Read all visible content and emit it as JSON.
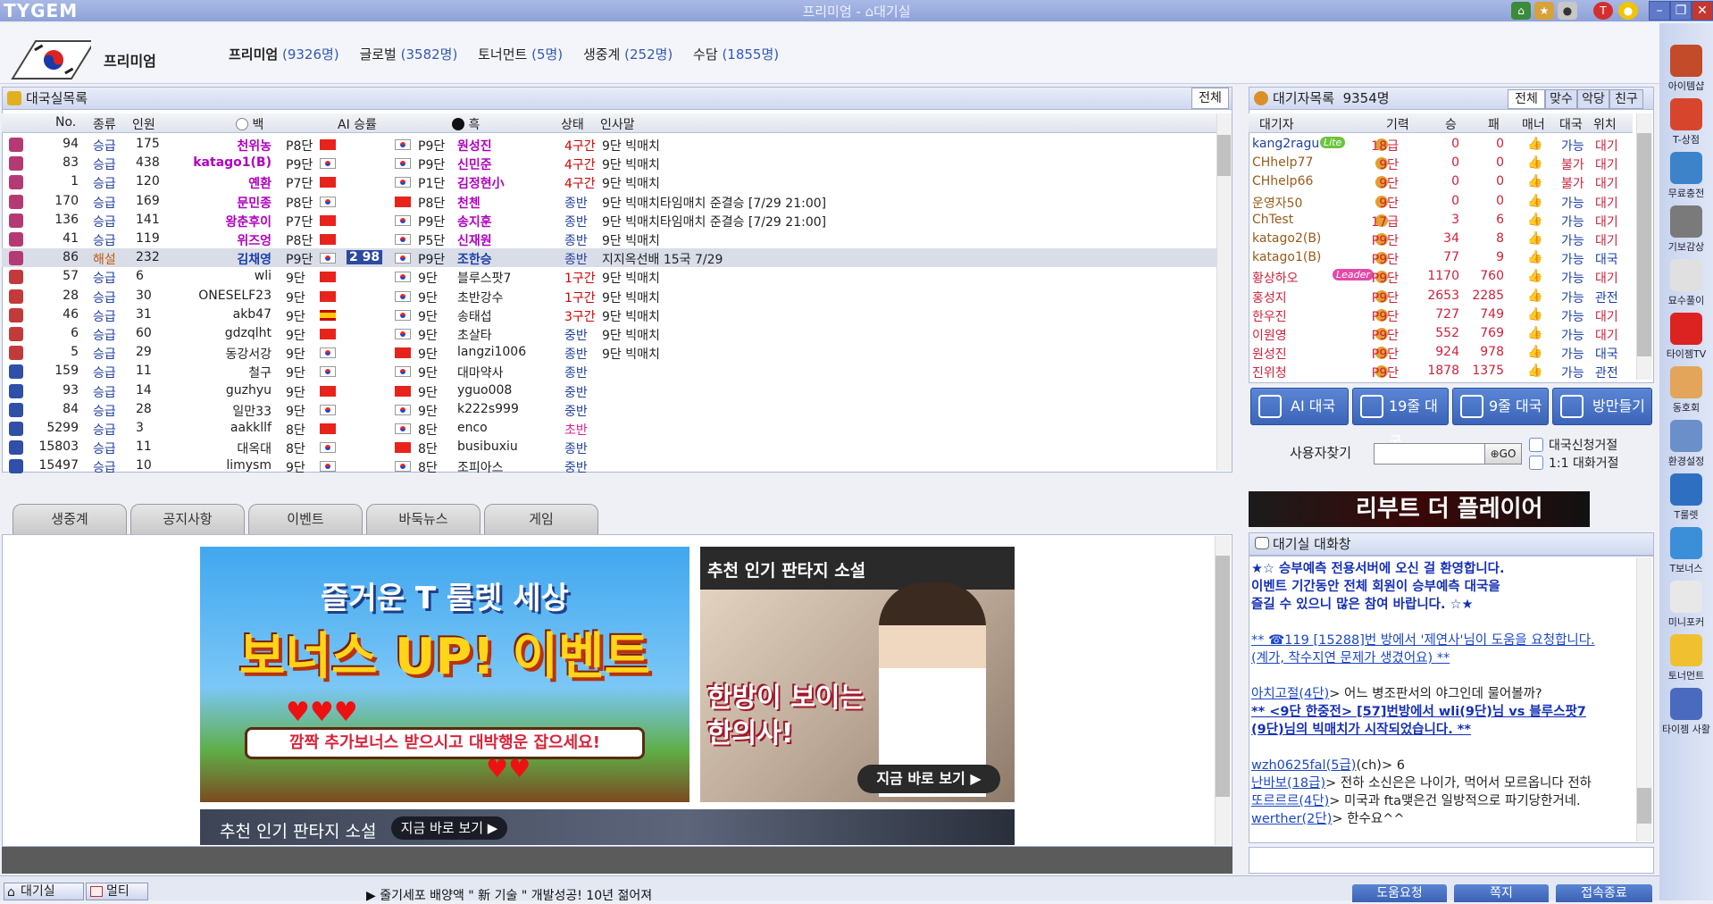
{
  "app": {
    "logo": "TYGEM",
    "window_title": "프리미엄 - ⌂대기실",
    "titlebar_icons": [
      "home-icon",
      "rank-icon",
      "puppy-icon",
      "t-icon",
      "bulb-icon"
    ]
  },
  "header": {
    "premium_label": "프리미엄",
    "servers": [
      {
        "name": "프리미엄",
        "count": "(9326명)"
      },
      {
        "name": "글로벌",
        "count": "(3582명)"
      },
      {
        "name": "토너먼트",
        "count": "(5명)"
      },
      {
        "name": "생중계",
        "count": "(252명)"
      },
      {
        "name": "수담",
        "count": "(1855명)"
      }
    ]
  },
  "gamelist": {
    "title": "대국실목록",
    "all_button": "전체",
    "columns": [
      "No.",
      "종류",
      "인원",
      "백",
      "AI 승률",
      "흑",
      "상태",
      "인사말"
    ],
    "rows": [
      {
        "no": "94",
        "type": "승급",
        "ppl": "175",
        "white": "천위농",
        "wrank": "P8단",
        "wflag": "cn",
        "bflag": "kr",
        "brank": "P9단",
        "black": "원성진",
        "state": "4구간",
        "msg": "9단 빅매치",
        "hl": "purple",
        "ic": "purple"
      },
      {
        "no": "83",
        "type": "승급",
        "ppl": "438",
        "white": "katago1(B)",
        "wrank": "P9단",
        "wflag": "kr",
        "bflag": "kr",
        "brank": "P9단",
        "black": "신민준",
        "state": "4구간",
        "msg": "9단 빅매치",
        "hl": "purple",
        "ic": "purple"
      },
      {
        "no": "1",
        "type": "승급",
        "ppl": "120",
        "white": "옌환",
        "wrank": "P7단",
        "wflag": "cn",
        "bflag": "kr",
        "brank": "P1단",
        "black": "김정현小",
        "state": "4구간",
        "msg": "9단 빅매치",
        "hl": "purple",
        "ic": "purple"
      },
      {
        "no": "170",
        "type": "승급",
        "ppl": "169",
        "white": "문민종",
        "wrank": "P8단",
        "wflag": "kr",
        "bflag": "cn",
        "brank": "P8단",
        "black": "천첸",
        "state": "종반",
        "msg": "9단 빅매치타임매치 준결승 [7/29 21:00]",
        "hl": "purple",
        "ic": "purple"
      },
      {
        "no": "136",
        "type": "승급",
        "ppl": "141",
        "white": "왕춘후이",
        "wrank": "P7단",
        "wflag": "cn",
        "bflag": "kr",
        "brank": "P9단",
        "black": "송지훈",
        "state": "종반",
        "msg": "9단 빅매치타임매치 준결승 [7/29 21:00]",
        "hl": "purple",
        "ic": "purple"
      },
      {
        "no": "41",
        "type": "승급",
        "ppl": "119",
        "white": "위즈엉",
        "wrank": "P8단",
        "wflag": "cn",
        "bflag": "kr",
        "brank": "P5단",
        "black": "신재원",
        "state": "종반",
        "msg": "9단 빅매치",
        "hl": "purple",
        "ic": "purple"
      },
      {
        "no": "86",
        "type": "해설",
        "ppl": "232",
        "white": "김채영",
        "wrank": "P9단",
        "wflag": "kr",
        "ai": "2 98",
        "bflag": "kr",
        "brank": "P9단",
        "black": "조한승",
        "state": "종반",
        "msg": "지지옥선배 15국 7/29",
        "hl": "blue",
        "ic": "purple",
        "sel": true
      },
      {
        "no": "57",
        "type": "승급",
        "ppl": "6",
        "white": "wli",
        "wrank": "9단",
        "wflag": "cn",
        "bflag": "kr",
        "brank": "9단",
        "black": "블루스팟7",
        "state": "1구간",
        "msg": "9단 빅매치",
        "hl": "none",
        "ic": "red"
      },
      {
        "no": "28",
        "type": "승급",
        "ppl": "30",
        "white": "ONESELF23",
        "wrank": "9단",
        "wflag": "cn",
        "bflag": "kr",
        "brank": "9단",
        "black": "초반강수",
        "state": "1구간",
        "msg": "9단 빅매치",
        "hl": "none",
        "ic": "red"
      },
      {
        "no": "46",
        "type": "승급",
        "ppl": "31",
        "white": "akb47",
        "wrank": "9단",
        "wflag": "es",
        "bflag": "kr",
        "brank": "9단",
        "black": "송태섭",
        "state": "3구간",
        "msg": "9단 빅매치",
        "hl": "none",
        "ic": "red"
      },
      {
        "no": "6",
        "type": "승급",
        "ppl": "60",
        "white": "gdzqlht",
        "wrank": "9단",
        "wflag": "cn",
        "bflag": "kr",
        "brank": "9단",
        "black": "초살타",
        "state": "중반",
        "msg": "9단 빅매치",
        "hl": "none",
        "ic": "red"
      },
      {
        "no": "5",
        "type": "승급",
        "ppl": "29",
        "white": "동강서강",
        "wrank": "9단",
        "wflag": "kr",
        "bflag": "cn",
        "brank": "9단",
        "black": "langzi1006",
        "state": "종반",
        "msg": "9단 빅매치",
        "hl": "none",
        "ic": "red"
      },
      {
        "no": "159",
        "type": "승급",
        "ppl": "11",
        "white": "철구",
        "wrank": "9단",
        "wflag": "kr",
        "bflag": "kr",
        "brank": "9단",
        "black": "대마약사",
        "state": "종반",
        "msg": "",
        "hl": "none",
        "ic": "blue"
      },
      {
        "no": "93",
        "type": "승급",
        "ppl": "14",
        "white": "guzhyu",
        "wrank": "9단",
        "wflag": "cn",
        "bflag": "cn",
        "brank": "9단",
        "black": "yguo008",
        "state": "중반",
        "msg": "",
        "hl": "none",
        "ic": "blue"
      },
      {
        "no": "84",
        "type": "승급",
        "ppl": "28",
        "white": "일만33",
        "wrank": "9단",
        "wflag": "kr",
        "bflag": "kr",
        "brank": "9단",
        "black": "k222s999",
        "state": "중반",
        "msg": "",
        "hl": "none",
        "ic": "blue"
      },
      {
        "no": "5299",
        "type": "승급",
        "ppl": "3",
        "white": "aakkllf",
        "wrank": "8단",
        "wflag": "cn",
        "bflag": "kr",
        "brank": "8단",
        "black": "enco",
        "state": "초반",
        "msg": "",
        "hl": "none",
        "ic": "blue"
      },
      {
        "no": "15803",
        "type": "승급",
        "ppl": "11",
        "white": "대옥대",
        "wrank": "8단",
        "wflag": "kr",
        "bflag": "cn",
        "brank": "8단",
        "black": "busibuxiu",
        "state": "종반",
        "msg": "",
        "hl": "none",
        "ic": "blue"
      },
      {
        "no": "15497",
        "type": "승급",
        "ppl": "10",
        "white": "limysm",
        "wrank": "9단",
        "wflag": "kr",
        "bflag": "kr",
        "brank": "8단",
        "black": "조피아스",
        "state": "중반",
        "msg": "",
        "hl": "none",
        "ic": "blue"
      }
    ]
  },
  "tabs": [
    "생중계",
    "공지사항",
    "이벤트",
    "바둑뉴스",
    "게임"
  ],
  "banners": {
    "b1_line1": "즐거운 T 룰렛 세상",
    "b1_line2": "보너스 UP! 이벤트",
    "b1_line3": "깜짝 추가보너스 받으시고 대박행운 잡으세요!",
    "b2_title": "추천 인기 판타지 소설",
    "b2_headline": "한방이 보이는 한의사!",
    "b2_cta": "지금 바로 보기 ▶",
    "b3_title": "추천 인기 판타지 소설",
    "b3_cta": "지금 바로 보기 ▶"
  },
  "waitlist": {
    "title": "대기자목록",
    "count": "9354명",
    "tabs": [
      "전체",
      "맞수",
      "악당",
      "친구"
    ],
    "columns": [
      "대기자",
      "기력",
      "승",
      "패",
      "매너",
      "대국",
      "위치"
    ],
    "rows": [
      {
        "name": "kang2ragu",
        "badge": "Lite",
        "rank": "18급",
        "w": "0",
        "l": "0",
        "game": "가능",
        "loc": "대기",
        "color": "blue"
      },
      {
        "name": "CHhelp77",
        "rank": "9단",
        "w": "0",
        "l": "0",
        "game": "불가",
        "loc": "대기",
        "color": "brown"
      },
      {
        "name": "CHhelp66",
        "rank": "9단",
        "w": "0",
        "l": "0",
        "game": "불가",
        "loc": "대기",
        "color": "brown"
      },
      {
        "name": "운영자50",
        "rank": "9단",
        "w": "0",
        "l": "0",
        "game": "가능",
        "loc": "대기",
        "color": "brown"
      },
      {
        "name": "ChTest",
        "rank": "17급",
        "w": "3",
        "l": "6",
        "game": "가능",
        "loc": "대기",
        "color": "brown"
      },
      {
        "name": "katago2(B)",
        "rank": "P9단",
        "w": "34",
        "l": "8",
        "game": "가능",
        "loc": "대기",
        "color": "brown"
      },
      {
        "name": "katago1(B)",
        "rank": "P9단",
        "w": "77",
        "l": "9",
        "game": "가능",
        "loc": "대국",
        "color": "brown"
      },
      {
        "name": "황상하오",
        "badge": "Leader",
        "rank": "P9단",
        "w": "1170",
        "l": "760",
        "game": "가능",
        "loc": "대기",
        "color": "red"
      },
      {
        "name": "홍성지",
        "rank": "P9단",
        "w": "2653",
        "l": "2285",
        "game": "가능",
        "loc": "관전",
        "color": "red"
      },
      {
        "name": "한우진",
        "rank": "P9단",
        "w": "727",
        "l": "749",
        "game": "가능",
        "loc": "대기",
        "color": "red"
      },
      {
        "name": "이원영",
        "rank": "P9단",
        "w": "552",
        "l": "769",
        "game": "가능",
        "loc": "대기",
        "color": "red"
      },
      {
        "name": "원성진",
        "rank": "P9단",
        "w": "924",
        "l": "978",
        "game": "가능",
        "loc": "대국",
        "color": "red"
      },
      {
        "name": "진위청",
        "rank": "P9단",
        "w": "1878",
        "l": "1375",
        "game": "가능",
        "loc": "관전",
        "color": "red"
      }
    ]
  },
  "actions": {
    "ai": "AI 대국",
    "b19": "19줄 대국",
    "b9": "9줄 대국",
    "make_room": "방만들기",
    "find_user": "사용자찾기",
    "go": "GO",
    "refuse_game": "대국신청거절",
    "refuse_chat": "1:1 대화거절"
  },
  "ad_banner": "리부트 더 플레이어",
  "chat": {
    "title": "대기실 대화창",
    "lines": [
      {
        "text": "★☆ 승부예측 전용서버에 오신 걸 환영합니다.",
        "style": "notice"
      },
      {
        "text": "이벤트 기간동안 전체 회원이 승부예측 대국을",
        "style": "notice"
      },
      {
        "text": "즐길 수 있으니 많은 참여 바랍니다. ☆★",
        "style": "notice"
      },
      {
        "text": "",
        "style": "blank"
      },
      {
        "text": "** ☎119 [15288]번 방에서 '제연사'님이 도움을 요청합니다.",
        "style": "link"
      },
      {
        "text": "(계가, 착수지연 문제가 생겼어요) **",
        "style": "link"
      },
      {
        "text": "",
        "style": "blank"
      },
      {
        "speaker": "아치고절(4단)",
        "text": "> 어느 병조판서의 야그인데 물어볼까?",
        "style": "chat"
      },
      {
        "text": "** <9단 한중전> [57]번방에서 wli(9단)님 vs 블루스팟7",
        "style": "boldlink"
      },
      {
        "text": "(9단)님의 빅매치가 시작되었습니다. **",
        "style": "boldlink"
      },
      {
        "text": "",
        "style": "blank"
      },
      {
        "speaker": "wzh0625fal(5급)",
        "text": "(ch)> 6",
        "style": "chat"
      },
      {
        "speaker": "난바보(18급)",
        "text": "> 전하 소신은은 나이가, 먹어서 모르옵니다 전하",
        "style": "chat"
      },
      {
        "speaker": "또르르르(4단)",
        "text": "> 미국과 fta맺은건 일방적으로 파기당한거네.",
        "style": "chat"
      },
      {
        "speaker": "werther(2단)",
        "text": "> 한수요^^",
        "style": "chat"
      }
    ]
  },
  "sidebar": [
    "아이템샵",
    "T-상점",
    "무료충전",
    "기보감상",
    "묘수풀이",
    "타이젬TV",
    "동호회",
    "환경설정",
    "T룰렛",
    "T보너스",
    "미니포커",
    "토너먼트",
    "타이젬 사활"
  ],
  "footer": {
    "lobby": "대기실",
    "multi": "멀티",
    "ticker": "▶ 줄기세포 배양액 \" 新 기술 \" 개발성공! 10년 젊어져",
    "help": "도움요청",
    "note": "쪽지",
    "exit": "접속종료"
  },
  "colors": {
    "accent": "#3b64b8",
    "purple": "#b000c0",
    "red_state": "#d40000"
  }
}
